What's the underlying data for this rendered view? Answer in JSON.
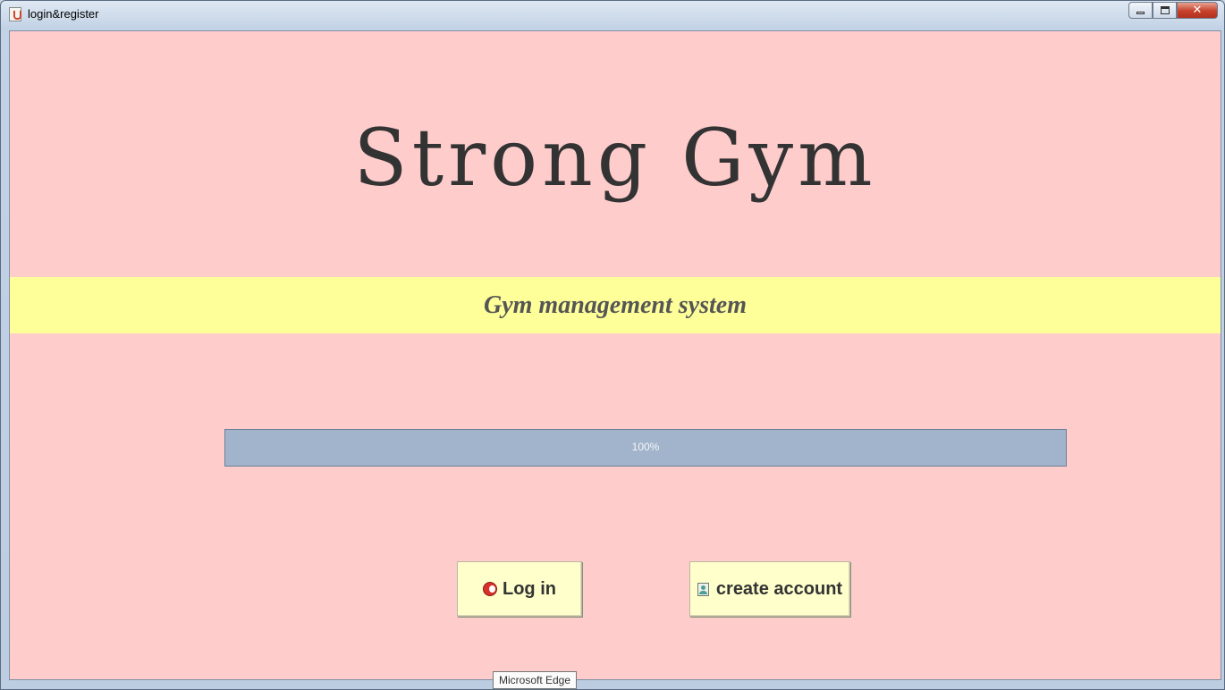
{
  "window": {
    "title": "login&register",
    "controls": {
      "close_glyph": "✕"
    }
  },
  "main": {
    "app_title": "Strong Gym",
    "subtitle": "Gym management system",
    "progress": {
      "value": 1.0,
      "text": "100%"
    },
    "buttons": {
      "login_label": "Log in",
      "login_icon": "power-icon",
      "create_label": "create account",
      "create_icon": "user-card-icon"
    }
  },
  "tooltip": {
    "text": "Microsoft Edge"
  },
  "colors": {
    "background": "#ffcccc",
    "band": "#ffff99",
    "button": "#ffffcc",
    "progress_fill": "#a2b4cb"
  }
}
